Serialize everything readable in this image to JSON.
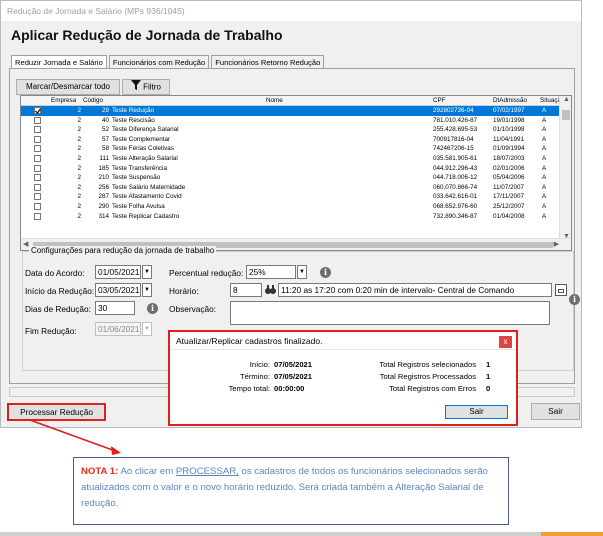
{
  "window": {
    "title": "Redução de Jornada e Salário (MPs 936/1045)",
    "heading": "Aplicar Redução de Jornada de Trabalho"
  },
  "tabs": [
    {
      "label": "Reduzir Jornada e Salário"
    },
    {
      "label": "Funcionários com Redução"
    },
    {
      "label": "Funcionários Retorno Redução"
    }
  ],
  "toolbar": {
    "toggle_label": "Marcar/Desmarcar todo",
    "filter_label": "Filtro"
  },
  "grid": {
    "columns": [
      "Empresa",
      "Código",
      "Nome",
      "CPF",
      "DtAdmissão",
      "Situação"
    ],
    "rows": [
      {
        "checked": true,
        "empresa": "2",
        "codigo": "29",
        "nome": "Teste Redução",
        "cpf": "292802736-04",
        "admissao": "07/02/1997",
        "situacao": "A"
      },
      {
        "checked": false,
        "empresa": "2",
        "codigo": "40",
        "nome": "Teste Rescisão",
        "cpf": "781.010.426-87",
        "admissao": "19/01/1998",
        "situacao": "A"
      },
      {
        "checked": false,
        "empresa": "2",
        "codigo": "52",
        "nome": "Teste Diferença Salarial",
        "cpf": "255.428.695-53",
        "admissao": "01/10/1998",
        "situacao": "A"
      },
      {
        "checked": false,
        "empresa": "2",
        "codigo": "57",
        "nome": "Teste Complementar",
        "cpf": "700917816-04",
        "admissao": "11/04/1991",
        "situacao": "A"
      },
      {
        "checked": false,
        "empresa": "2",
        "codigo": "58",
        "nome": "Teste Férias Coletivas",
        "cpf": "742467206-15",
        "admissao": "01/09/1994",
        "situacao": "A"
      },
      {
        "checked": false,
        "empresa": "2",
        "codigo": "111",
        "nome": "Teste Alteração Salarial",
        "cpf": "035.581.905-61",
        "admissao": "18/07/2003",
        "situacao": "A"
      },
      {
        "checked": false,
        "empresa": "2",
        "codigo": "185",
        "nome": "Teste Transferência",
        "cpf": "044.912.296-43",
        "admissao": "02/01/2006",
        "situacao": "A"
      },
      {
        "checked": false,
        "empresa": "2",
        "codigo": "210",
        "nome": "Teste Suspensão",
        "cpf": "044.718.006-12",
        "admissao": "05/04/2006",
        "situacao": "A"
      },
      {
        "checked": false,
        "empresa": "2",
        "codigo": "256",
        "nome": "Teste Salário Maternidade",
        "cpf": "060.070.866-74",
        "admissao": "11/07/2007",
        "situacao": "A"
      },
      {
        "checked": false,
        "empresa": "2",
        "codigo": "287",
        "nome": "Teste Afastamento Covid",
        "cpf": "033.642.616-01",
        "admissao": "17/11/2007",
        "situacao": "A"
      },
      {
        "checked": false,
        "empresa": "2",
        "codigo": "290",
        "nome": "Teste Folha Avulsa",
        "cpf": "068.652.976-60",
        "admissao": "25/12/2007",
        "situacao": "A"
      },
      {
        "checked": false,
        "empresa": "2",
        "codigo": "314",
        "nome": "Teste Replicar Cadastro",
        "cpf": "732.890.346-87",
        "admissao": "01/04/2008",
        "situacao": "A"
      }
    ]
  },
  "config": {
    "group_title": "Configurações para redução da jornada de trabalho",
    "data_acordo_label": "Data do Acordo:",
    "data_acordo_value": "01/05/2021",
    "inicio_label": "Início da Redução:",
    "inicio_value": "03/05/2021",
    "dias_label": "Dias de Redução:",
    "dias_value": "30",
    "fim_label": "Fim Redução:",
    "fim_value": "01/06/2021",
    "percentual_label": "Percentual redução:",
    "percentual_value": "25%",
    "horario_label": "Horário:",
    "horario_code": "8",
    "horario_desc": "11:20 as 17:20 com 0:20 min de intervalo- Central de Comando",
    "observacao_label": "Observação:"
  },
  "popup": {
    "title": "Atualizar/Replicar cadastros finalizado.",
    "close_label": "x",
    "inicio_label": "Início:",
    "inicio_value": "07/05/2021",
    "termino_label": "Término:",
    "termino_value": "07/05/2021",
    "tempo_label": "Tempo total:",
    "tempo_value": "00:00:00",
    "sel_label": "Total Registros selecionados",
    "sel_value": "1",
    "proc_label": "Total Registros Processados",
    "proc_value": "1",
    "err_label": "Total Registros com Erros",
    "err_value": "0",
    "sair_label": "Sair"
  },
  "footer": {
    "processar_label": "Processar Redução",
    "sair_label": "Sair"
  },
  "note": {
    "title": "NOTA 1:",
    "text_before": " Ao clicar em ",
    "underlined": "PROCESSAR,",
    "text_after": " os cadastros de todos os funcionários selecionados serão atualizados com o valor e o novo horário reduzido. Será criada também a Alteração Salarial de redução."
  },
  "colors": {
    "selection": "#0078d7",
    "highlight_red": "#e01f1f",
    "note_text": "#5b86c3"
  }
}
